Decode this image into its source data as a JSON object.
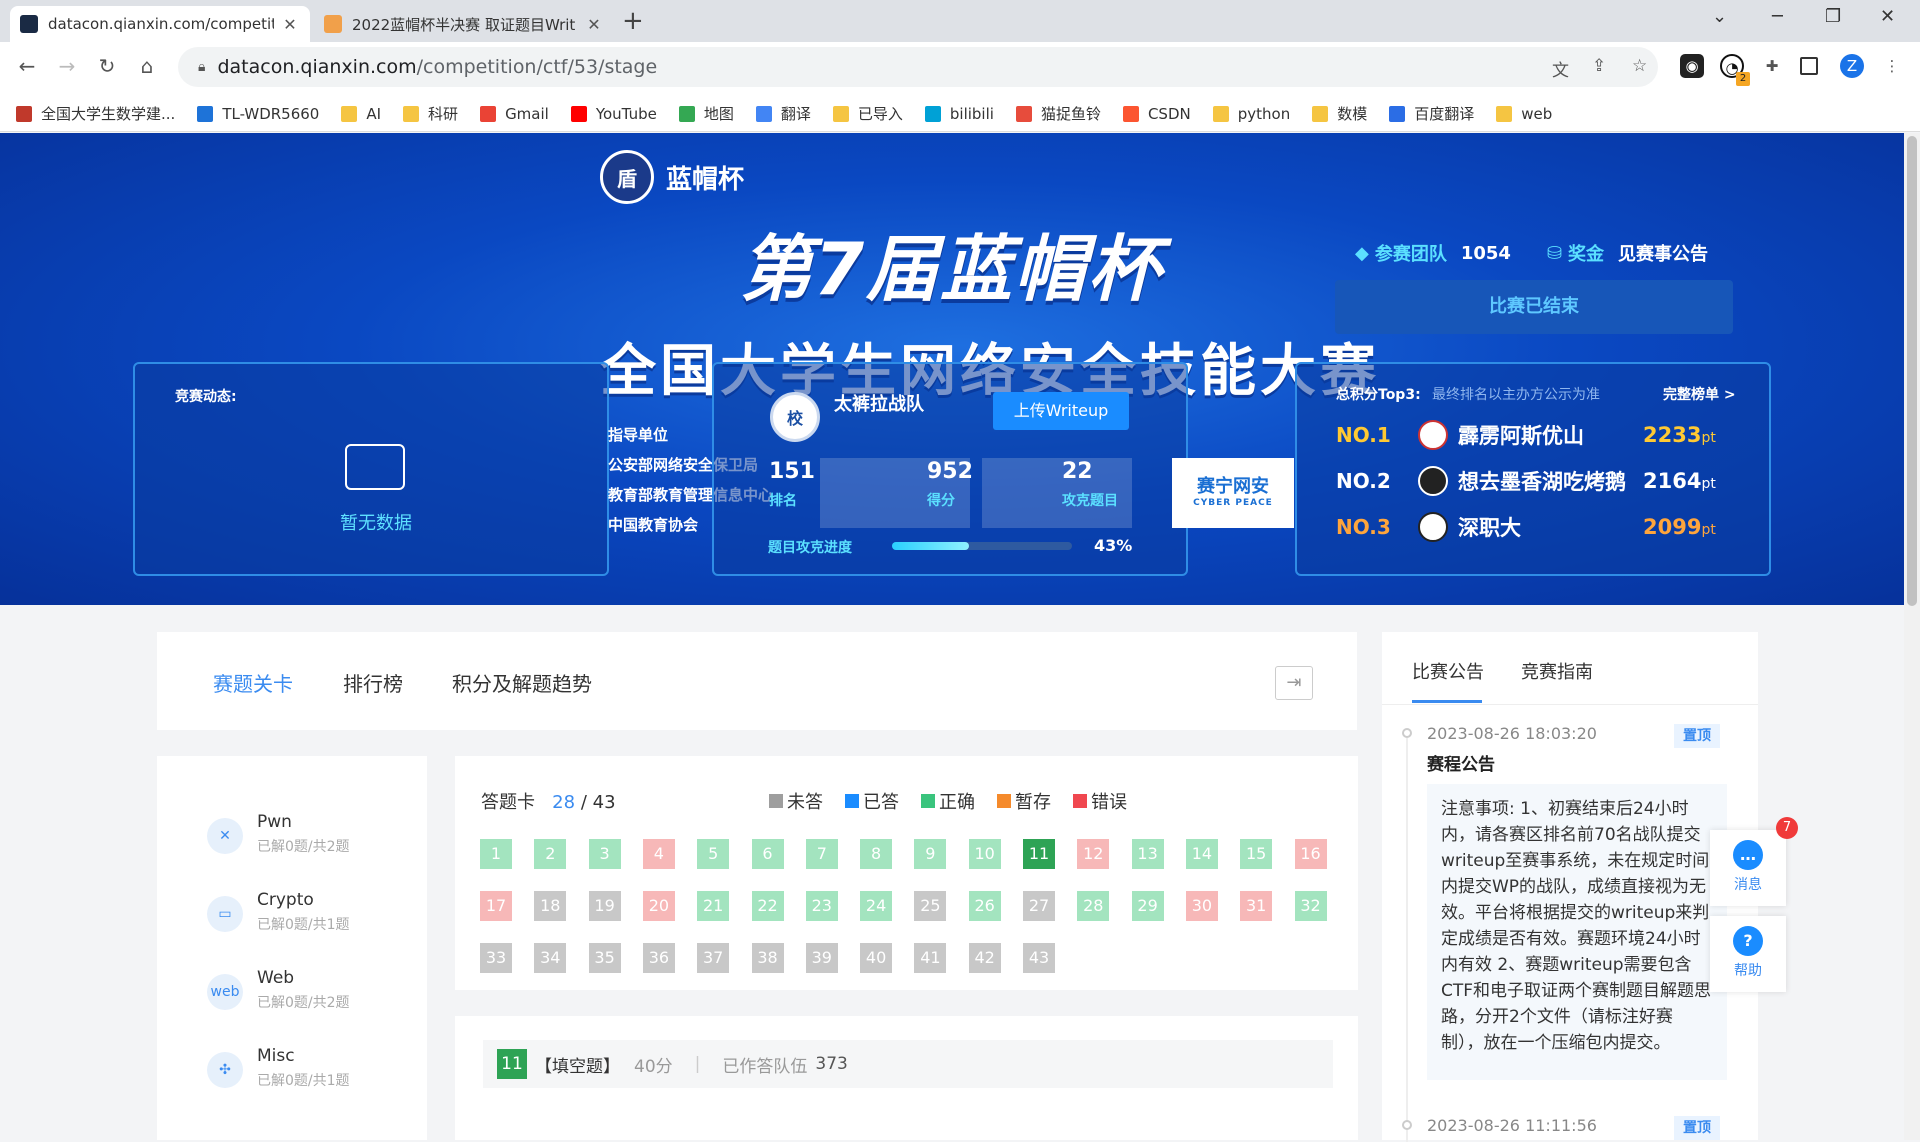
{
  "browser": {
    "tabs": [
      {
        "title": "datacon.qianxin.com/competiti",
        "active": true
      },
      {
        "title": "2022蓝帽杯半决赛 取证题目Writ",
        "active": false
      }
    ],
    "url_host": "datacon.qianxin.com",
    "url_path": "/competition/ctf/53/stage",
    "profile_initial": "Z",
    "ext_badge": "2"
  },
  "bookmarks": [
    {
      "label": "全国大学生数学建...",
      "color": "#c0392b",
      "icon": "math-icon"
    },
    {
      "label": "TL-WDR5660",
      "color": "#1e73d8",
      "icon": "tp-icon"
    },
    {
      "label": "AI",
      "color": "#f5c542",
      "icon": "folder-icon"
    },
    {
      "label": "科研",
      "color": "#f5c542",
      "icon": "folder-icon"
    },
    {
      "label": "Gmail",
      "color": "#ea4335",
      "icon": "gmail-icon"
    },
    {
      "label": "YouTube",
      "color": "#ff0000",
      "icon": "youtube-icon"
    },
    {
      "label": "地图",
      "color": "#34a853",
      "icon": "map-icon"
    },
    {
      "label": "翻译",
      "color": "#4285f4",
      "icon": "translate-icon"
    },
    {
      "label": "已导入",
      "color": "#f5c542",
      "icon": "folder-icon"
    },
    {
      "label": "bilibili",
      "color": "#00a1d6",
      "icon": "bilibili-icon"
    },
    {
      "label": "猫捉鱼铃",
      "color": "#e74c3c",
      "icon": "cat-icon"
    },
    {
      "label": "CSDN",
      "color": "#fc5531",
      "icon": "csdn-icon"
    },
    {
      "label": "python",
      "color": "#f5c542",
      "icon": "folder-icon"
    },
    {
      "label": "数模",
      "color": "#f5c542",
      "icon": "folder-icon"
    },
    {
      "label": "百度翻译",
      "color": "#2b6de5",
      "icon": "baidu-translate-icon"
    },
    {
      "label": "web",
      "color": "#f5c542",
      "icon": "folder-icon"
    }
  ],
  "banner": {
    "logo_text": "蓝帽杯",
    "title_line1": "第7届蓝帽杯",
    "title_line2": "全国大学生网络安全技能大赛",
    "teams_label": "参赛团队",
    "teams_count": "1054",
    "prize_label": "奖金",
    "prize_value": "见赛事公告",
    "status_button": "比赛已结束",
    "news_title": "竞赛动态:",
    "no_data": "暂无数据",
    "sponsors": [
      "指导单位",
      "公安部网络安全保卫局",
      "教育部教育管理信息中心",
      "中国教育协会"
    ],
    "team": {
      "name": "太裤拉战队",
      "upload_button": "上传Writeup",
      "rank_value": "151",
      "rank_label": "排名",
      "score_value": "952",
      "score_label": "得分",
      "solved_value": "22",
      "solved_label": "攻克题目",
      "progress_label": "题目攻克进度",
      "progress_pct": "43%",
      "progress_fraction": 0.43
    },
    "cyber_peace": "赛宁网安",
    "cyber_peace_en": "CYBER PEACE",
    "ranking": {
      "title": "总积分Top3:",
      "subtitle": "最终排名以主办方公示为准",
      "full_link": "完整榜单 >",
      "items": [
        {
          "no": "NO.1",
          "name": "霹雳阿斯优山",
          "score": "2233",
          "unit": "pt"
        },
        {
          "no": "NO.2",
          "name": "想去墨香湖吃烤鹅",
          "score": "2164",
          "unit": "pt"
        },
        {
          "no": "NO.3",
          "name": "深职大",
          "score": "2099",
          "unit": "pt"
        }
      ]
    }
  },
  "main_tabs": [
    "赛题关卡",
    "排行榜",
    "积分及解题趋势"
  ],
  "announcements": {
    "tabs": [
      "比赛公告",
      "竞赛指南"
    ],
    "items": [
      {
        "date": "2023-08-26 18:03:20",
        "pin": "置顶",
        "title": "赛程公告",
        "body": "注意事项: 1、初赛结束后24小时内，请各赛区排名前70名战队提交writeup至赛事系统，未在规定时间内提交WP的战队，成绩直接视为无效。平台将根据提交的writeup来判定成绩是否有效。赛题环境24小时内有效 2、赛题writeup需要包含CTF和电子取证两个赛制题目解题思路，分开2个文件（请标注好赛制），放在一个压缩包内提交。"
      },
      {
        "date": "2023-08-26 11:11:56",
        "pin": "置顶"
      }
    ]
  },
  "categories": [
    {
      "name": "Pwn",
      "sub": "已解0题/共2题",
      "icon": "pwn-icon",
      "glyph": "✕"
    },
    {
      "name": "Crypto",
      "sub": "已解0题/共1题",
      "icon": "crypto-icon",
      "glyph": "▭"
    },
    {
      "name": "Web",
      "sub": "已解0题/共2题",
      "icon": "web-icon",
      "glyph": "web"
    },
    {
      "name": "Misc",
      "sub": "已解0题/共1题",
      "icon": "misc-icon",
      "glyph": "✣"
    }
  ],
  "answer_sheet": {
    "title": "答题卡",
    "answered": "28",
    "separator": "/",
    "total": "43",
    "legend": [
      {
        "label": "未答",
        "color": "#9e9e9e"
      },
      {
        "label": "已答",
        "color": "#1a8cff"
      },
      {
        "label": "正确",
        "color": "#3ac47d"
      },
      {
        "label": "暂存",
        "color": "#f58a2b"
      },
      {
        "label": "错误",
        "color": "#f0474f"
      }
    ],
    "cells": [
      "ok",
      "ok",
      "ok",
      "bad",
      "ok",
      "ok",
      "ok",
      "ok",
      "ok",
      "ok",
      "cur",
      "bad",
      "ok",
      "ok",
      "ok",
      "bad",
      "bad",
      "none",
      "none",
      "bad",
      "ok",
      "ok",
      "ok",
      "ok",
      "none",
      "ok",
      "none",
      "ok",
      "ok",
      "bad",
      "bad",
      "ok",
      "none",
      "none",
      "none",
      "none",
      "none",
      "none",
      "none",
      "none",
      "none",
      "none",
      "none"
    ]
  },
  "question": {
    "num": "11",
    "type": "【填空题】",
    "points": "40分",
    "sep": "|",
    "teams_label": "已作答队伍",
    "teams": "373"
  },
  "float_buttons": {
    "messages": "消息",
    "messages_badge": "7",
    "help": "帮助"
  }
}
